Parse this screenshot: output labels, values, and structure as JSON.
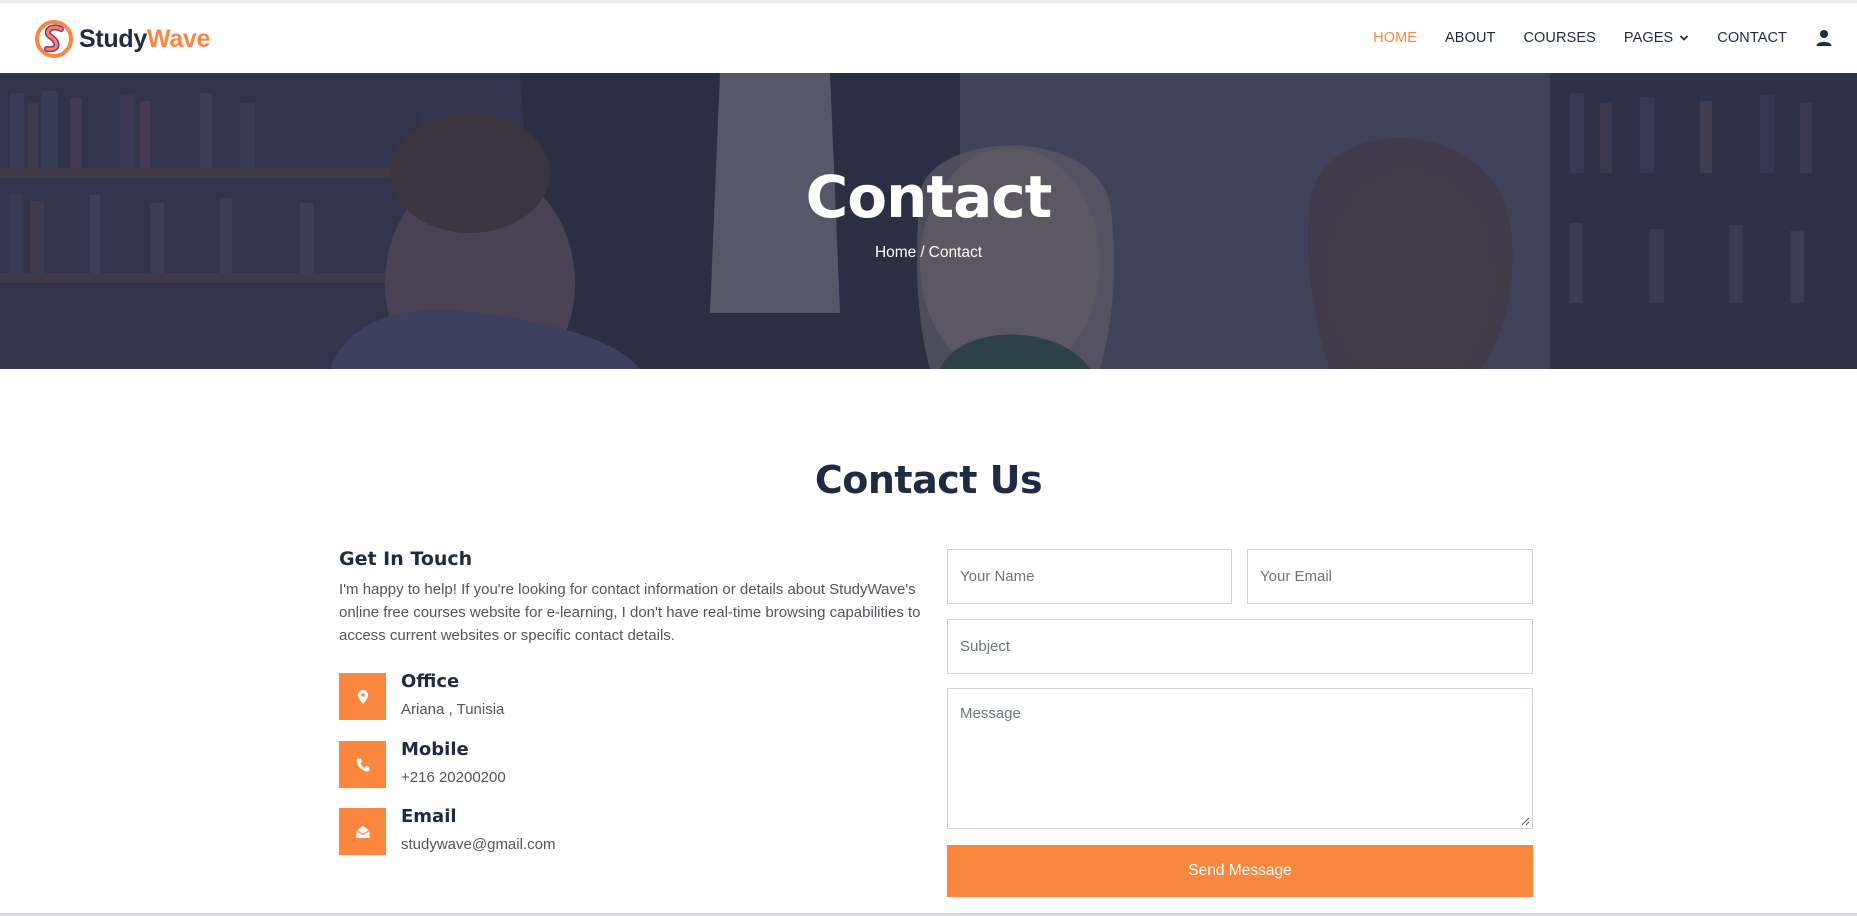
{
  "brand": {
    "name_part1": "Study",
    "name_part2": "Wave"
  },
  "nav": {
    "items": [
      {
        "label": "HOME",
        "active": true
      },
      {
        "label": "ABOUT"
      },
      {
        "label": "COURSES"
      },
      {
        "label": "PAGES"
      },
      {
        "label": "CONTACT"
      }
    ]
  },
  "hero": {
    "title": "Contact",
    "breadcrumb": {
      "home": "Home",
      "separator": "/",
      "current": "Contact"
    }
  },
  "section": {
    "title": "Contact Us"
  },
  "info": {
    "heading": "Get In Touch",
    "text": "I'm happy to help! If you're looking for contact information or details about StudyWave's online free courses website for e-learning, I don't have real-time browsing capabilities to access current websites or specific contact details.",
    "rows": [
      {
        "label": "Office",
        "value": "Ariana , Tunisia",
        "icon": "map-pin-icon"
      },
      {
        "label": "Mobile",
        "value": "+216 20200200",
        "icon": "phone-icon"
      },
      {
        "label": "Email",
        "value": "studywave@gmail.com",
        "icon": "envelope-open-icon"
      }
    ]
  },
  "form": {
    "name_placeholder": "Your Name",
    "email_placeholder": "Your Email",
    "subject_placeholder": "Subject",
    "message_placeholder": "Message",
    "send_label": "Send Message"
  },
  "colors": {
    "accent": "#fb873f",
    "dark": "#1f2a44",
    "text": "#52565b"
  }
}
